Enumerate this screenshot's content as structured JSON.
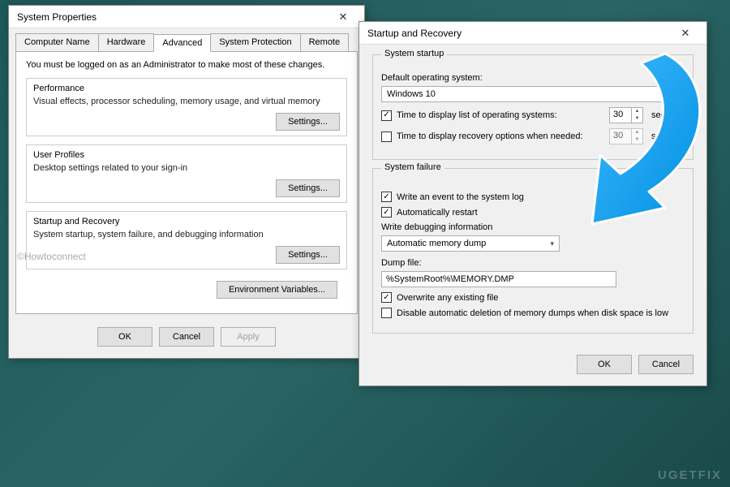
{
  "sysprops": {
    "title": "System Properties",
    "tabs": [
      "Computer Name",
      "Hardware",
      "Advanced",
      "System Protection",
      "Remote"
    ],
    "active_tab": 2,
    "intro": "You must be logged on as an Administrator to make most of these changes.",
    "performance": {
      "title": "Performance",
      "desc": "Visual effects, processor scheduling, memory usage, and virtual memory",
      "button": "Settings..."
    },
    "profiles": {
      "title": "User Profiles",
      "desc": "Desktop settings related to your sign-in",
      "button": "Settings..."
    },
    "startup": {
      "title": "Startup and Recovery",
      "desc": "System startup, system failure, and debugging information",
      "button": "Settings..."
    },
    "env_button": "Environment Variables...",
    "buttons": {
      "ok": "OK",
      "cancel": "Cancel",
      "apply": "Apply"
    }
  },
  "sr": {
    "title": "Startup and Recovery",
    "startup_section": "System startup",
    "default_os_label": "Default operating system:",
    "default_os_value": "Windows 10",
    "time_list": {
      "checked": true,
      "label": "Time to display list of operating systems:",
      "value": "30",
      "unit": "seconds"
    },
    "time_recovery": {
      "checked": false,
      "label": "Time to display recovery options when needed:",
      "value": "30",
      "unit": "seconds"
    },
    "failure_section": "System failure",
    "write_event": {
      "checked": true,
      "label": "Write an event to the system log"
    },
    "auto_restart": {
      "checked": true,
      "label": "Automatically restart"
    },
    "debug_label": "Write debugging information",
    "debug_value": "Automatic memory dump",
    "dump_label": "Dump file:",
    "dump_value": "%SystemRoot%\\MEMORY.DMP",
    "overwrite": {
      "checked": true,
      "label": "Overwrite any existing file"
    },
    "disable_delete": {
      "checked": false,
      "label": "Disable automatic deletion of memory dumps when disk space is low"
    },
    "buttons": {
      "ok": "OK",
      "cancel": "Cancel"
    }
  },
  "attribution": "©Howtoconnect",
  "watermark": "UGETFIX"
}
